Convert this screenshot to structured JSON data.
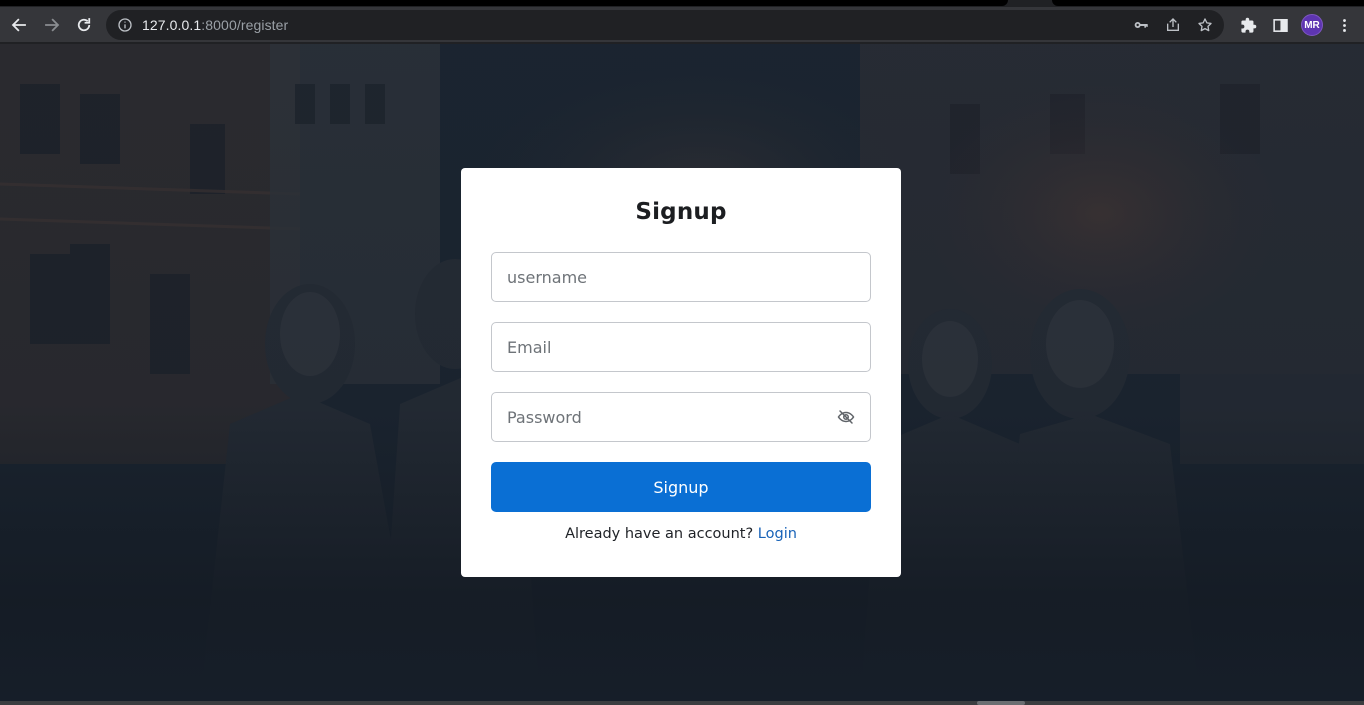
{
  "browser": {
    "url_host": "127.0.0.1",
    "url_path": ":8000/register",
    "profile_initials": "MR",
    "profile_color": "#5e35b1"
  },
  "icons": {
    "back": "arrow-left-icon",
    "forward": "arrow-right-icon",
    "reload": "reload-icon",
    "site_info": "info-icon",
    "password_key": "key-icon",
    "share": "share-icon",
    "bookmark": "star-icon",
    "extensions": "puzzle-icon",
    "side_panel": "side-panel-icon",
    "menu": "kebab-menu-icon",
    "password_toggle": "eye-off-icon"
  },
  "form": {
    "title": "Signup",
    "username_placeholder": "username",
    "email_placeholder": "Email",
    "password_placeholder": "Password",
    "submit_label": "Signup",
    "footer_text": "Already have an account? ",
    "footer_link": "Login"
  },
  "colors": {
    "primary_button": "#0a6fd4",
    "link": "#1863b8",
    "card_background": "#ffffff"
  }
}
